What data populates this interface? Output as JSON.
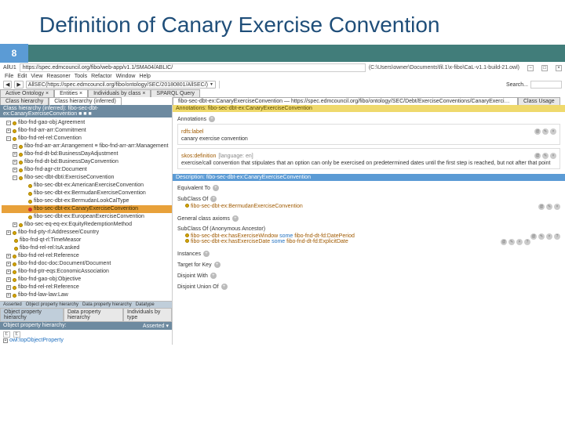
{
  "title": "Definition of Canary Exercise Convention",
  "page_number": "8",
  "app": {
    "url_prefix": "AllU1",
    "url": "https://spec.edmcouncil.org/fibo/web-app/v1.1/SMA04/ABLIC/",
    "path": "(C:\\Users\\owner\\Documents\\fil.1\\x-fibo\\CaL-v1.1-build-21.owl)",
    "menubar": [
      "File",
      "Edit",
      "View",
      "Reasoner",
      "Tools",
      "Refactor",
      "Window",
      "Help"
    ],
    "ontology_btn": "AllSEC",
    "ontology_path": "(https://spec.edmcouncil.org/fibo/ontology/SEC/20180801/AllSEC/)",
    "search_label": "Search...",
    "win_close": "×"
  },
  "tabs": {
    "row": [
      "Active Ontology ×",
      "Entities ×",
      "Individuals by class ×",
      "SPARQL Query"
    ],
    "sub": [
      "Class hierarchy",
      "Class hierarchy (inferred)"
    ],
    "right": [
      "fibo-sec-dbt-ex:CanaryExerciseConvention — https://spec.edmcouncil.org/fibo/ontology/SEC/Debt/ExerciseConventions/CanaryExerciseConvention",
      "Class Usage"
    ]
  },
  "inferred_header": "Class hierarchy (inferred): fibo-sec-dbt-ex:CanaryExerciseConvention ■ ■ ■",
  "tree": {
    "items": [
      {
        "lvl": 0,
        "box": "−",
        "text": "fibo-fnd-gao-obj:Agreement"
      },
      {
        "lvl": 0,
        "box": "+",
        "text": "fibo-fnd-arr-arr:Commitment"
      },
      {
        "lvl": 0,
        "box": "−",
        "text": "fibo-fnd-rel-rel:Convention"
      },
      {
        "lvl": 1,
        "box": "+",
        "text": "fibo-fnd-arr-arr:Arrangement ≡ fibo-fnd-arr-arr:Management"
      },
      {
        "lvl": 1,
        "box": "+",
        "text": "fibo-fnd-dt-bd:BusinessDayAdjustment"
      },
      {
        "lvl": 1,
        "box": "+",
        "text": "fibo-fnd-dt-bd:BusinessDayConvention"
      },
      {
        "lvl": 1,
        "box": "+",
        "text": "fibo-fnd-agr-ctr:Document"
      },
      {
        "lvl": 1,
        "box": "−",
        "text": "fibo-sec-dbt-dbti:ExerciseConvention"
      },
      {
        "lvl": 2,
        "box": "",
        "text": "fibo-sec-dbt-ex:AmericanExerciseConvention"
      },
      {
        "lvl": 2,
        "box": "",
        "text": "fibo-sec-dbt-ex:BermudanExerciseConvention"
      },
      {
        "lvl": 2,
        "box": "",
        "text": "fibo-sec-dbt-ex:BermudanLookCalType"
      },
      {
        "lvl": 2,
        "box": "",
        "text": "fibo-sec-dbt-ex:CanaryExerciseConvention",
        "selected": true
      },
      {
        "lvl": 2,
        "box": "",
        "text": "fibo-sec-dbt-ex:EuropeanExerciseConvention"
      },
      {
        "lvl": 1,
        "box": "+",
        "text": "fibo-sec-eq-eq-ex:EquityRedemptionMethod"
      },
      {
        "lvl": 0,
        "box": "+",
        "text": "fibo-fnd-pty-rl:Addressee/Country"
      },
      {
        "lvl": 0,
        "box": "",
        "text": "fibo-fnd-qt-rl:TimeMeasor"
      },
      {
        "lvl": 0,
        "box": "",
        "text": "fibo-fnd-rel-rel:IsA:asked"
      },
      {
        "lvl": 0,
        "box": "+",
        "text": "fibo-fnd-rel-rel:Reference"
      },
      {
        "lvl": 0,
        "box": "+",
        "text": "fibo-fnd-doc-doc:Document/Document"
      },
      {
        "lvl": 0,
        "box": "+",
        "text": "fibo-fnd-ptr-eqs:EconomicAssociation"
      },
      {
        "lvl": 0,
        "box": "+",
        "text": "fibo-fnd-gao-obj:Objective"
      },
      {
        "lvl": 0,
        "box": "+",
        "text": "fibo-fnd-rel-rel:Reference"
      },
      {
        "lvl": 0,
        "box": "+",
        "text": "fibo-fnd-law-law:Law"
      }
    ]
  },
  "annotations": {
    "header": "Annotations: fibo-sec-dbt-ex:CanaryExerciseConvention",
    "rdfs_label_k": "rdfs:label",
    "rdfs_label_v": "canary exercise convention",
    "skos_def_k": "skos:definition",
    "skos_def_lang": "[language: en]",
    "skos_def_v": "exercise/call convention that stipulates that an option can only be exercised on predetermined dates until the first step is reached, but not after that point"
  },
  "description": {
    "header": "Description: fibo-sec-dbt-ex:CanaryExerciseConvention",
    "equivalent": "Equivalent To",
    "subclass": "SubClass Of",
    "subclass_v": "fibo-sec-dbt-ex:BermudanExerciseConvention",
    "gca": "General class axioms",
    "sca": "SubClass Of (Anonymous Ancestor)",
    "sca_v1_a": "fibo-sec-dbt-ex:hasExerciseWindow",
    "sca_v1_some": "some",
    "sca_v1_b": "fibo-fnd-dt-fd:DatePeriod",
    "sca_v2_a": "fibo-sec-dbt-ex:hasExerciseDate",
    "sca_v2_some": "some",
    "sca_v2_b": "fibo-fnd-dt-fd:ExplicitDate",
    "instances": "Instances",
    "target": "Target for Key",
    "disjoint": "Disjoint With",
    "disjoint_union": "Disjoint Union Of"
  },
  "obj_prop": {
    "tabs": [
      "Object property hierarchy",
      "Data property hierarchy",
      "Individuals by type",
      "Datatype"
    ],
    "header": "Object property hierarchy:",
    "asserted": "Asserted ▾",
    "root": "owl:topObjectProperty"
  }
}
